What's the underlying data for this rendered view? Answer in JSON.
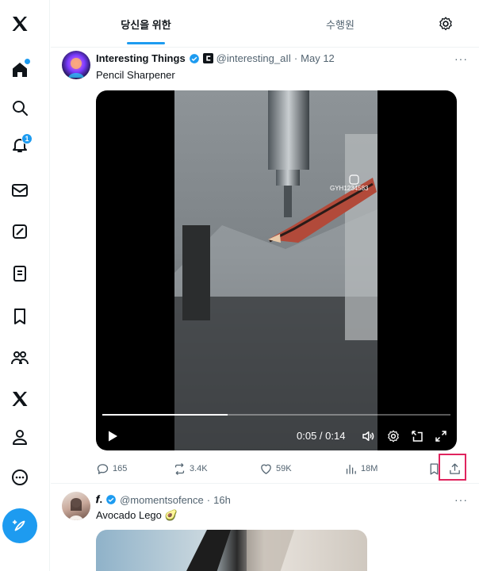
{
  "nav": {
    "items": [
      {
        "icon": "x-logo-icon"
      },
      {
        "icon": "home-icon",
        "has_dot": true
      },
      {
        "icon": "search-icon"
      },
      {
        "icon": "notifications-icon",
        "badge": "1"
      },
      {
        "icon": "messages-icon"
      },
      {
        "icon": "grok-icon"
      },
      {
        "icon": "lists-icon"
      },
      {
        "icon": "bookmarks-icon"
      },
      {
        "icon": "communities-icon"
      },
      {
        "icon": "premium-icon"
      },
      {
        "icon": "profile-icon"
      },
      {
        "icon": "more-icon"
      }
    ],
    "post_button_icon": "compose-icon"
  },
  "tabs": {
    "active": "당신을 위한",
    "second": "수행원"
  },
  "tweet1": {
    "name": "Interesting Things",
    "handle": "@interesting_aIl",
    "separator": "·",
    "date": "May 12",
    "text": "Pencil Sharpener",
    "more": "···",
    "video": {
      "watermark": "GYH1234583",
      "time": "0:05 / 0:14",
      "progress": 0.36
    },
    "actions": {
      "replies": "165",
      "reposts": "3.4K",
      "likes": "59K",
      "views": "18M"
    }
  },
  "tweet2": {
    "name": "𝒇.",
    "handle": "@momentsofence",
    "separator": "·",
    "date": "16h",
    "text": "Avocado Lego 🥑",
    "more": "···"
  },
  "colors": {
    "accent": "#1d9bf0",
    "text": "#0f1419",
    "muted": "#536471",
    "highlight": "#e0245e"
  }
}
